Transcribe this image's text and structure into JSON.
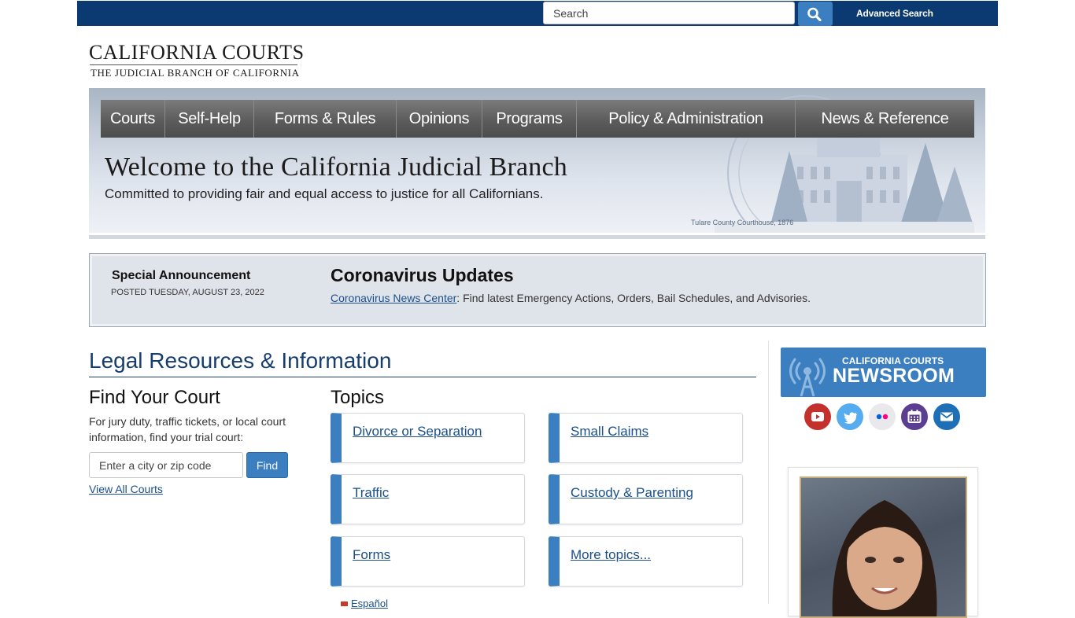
{
  "search": {
    "placeholder": "Search",
    "advanced_label": "Advanced Search"
  },
  "logo": {
    "main": "CALIFORNIA COURTS",
    "sub": "THE JUDICIAL BRANCH OF CALIFORNIA"
  },
  "nav": {
    "items": [
      "Courts",
      "Self-Help",
      "Forms & Rules",
      "Opinions",
      "Programs",
      "Policy & Administration",
      "News & Reference"
    ]
  },
  "hero": {
    "title": "Welcome to the California Judicial Branch",
    "subtitle": "Committed to providing fair and equal access to justice for all Californians.",
    "caption": "Tulare County Courthouse, 1876"
  },
  "announcement": {
    "label": "Special Announcement",
    "date": "POSTED TUESDAY, AUGUST 23, 2022",
    "title": "Coronavirus Updates",
    "link_text": "Coronavirus News Center",
    "body_text": ": Find latest Emergency Actions, Orders, Bail Schedules, and Advisories."
  },
  "legal": {
    "title": "Legal Resources & Information",
    "find_court": {
      "title": "Find Your Court",
      "description": "For jury duty, traffic tickets, or local court information, find your trial court:",
      "placeholder": "Enter a city or zip code",
      "button": "Find",
      "view_all": "View All Courts"
    },
    "topics": {
      "title": "Topics",
      "items": [
        "Divorce or Separation",
        "Small Claims",
        "Traffic",
        "Custody & Parenting",
        "Forms",
        "More topics..."
      ]
    },
    "espanol": "Español"
  },
  "newsroom": {
    "line1": "CALIFORNIA COURTS",
    "line2": "NEWSROOM"
  },
  "social": {
    "icons": [
      "youtube-icon",
      "twitter-icon",
      "flickr-icon",
      "calendar-icon",
      "email-icon"
    ],
    "colors": [
      "#c4302b",
      "#55acee",
      "#e9e9ec",
      "#5b3d91",
      "#1f6fb6"
    ]
  },
  "colors": {
    "topbar": "#0b3a73",
    "accent": "#3b7fc0",
    "heading_blue": "#163d6d"
  }
}
